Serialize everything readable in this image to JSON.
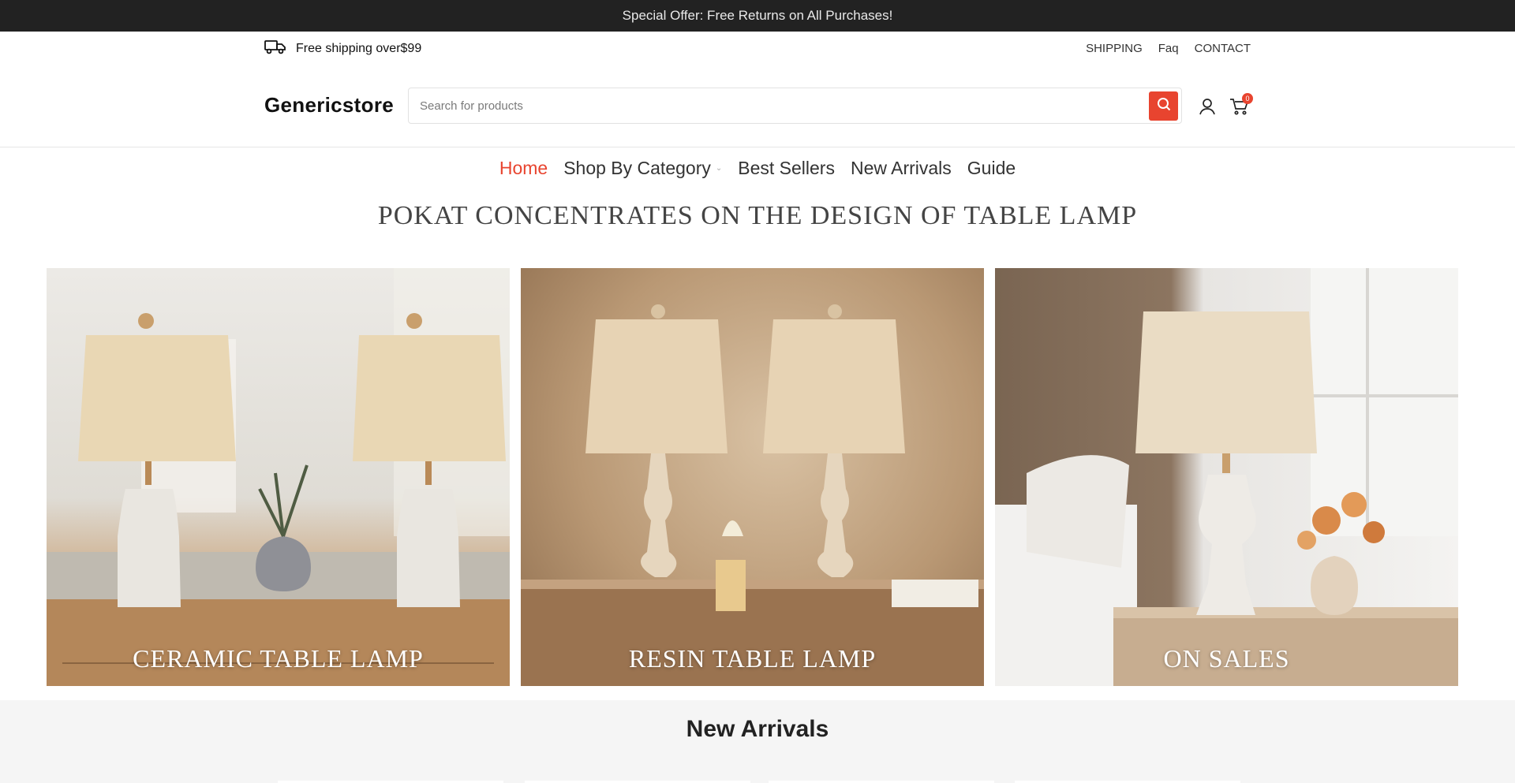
{
  "announcement": "Special Offer: Free Returns on All Purchases!",
  "topbar": {
    "shipping_text": "Free shipping over$99",
    "links": [
      "SHIPPING",
      "Faq",
      "CONTACT"
    ]
  },
  "header": {
    "logo": "Genericstore",
    "search_placeholder": "Search for products",
    "cart_count": "0"
  },
  "nav": {
    "items": [
      "Home",
      "Shop By Category",
      "Best Sellers",
      "New Arrivals",
      "Guide"
    ],
    "active": "Home"
  },
  "headline": "POKAT CONCENTRATES ON THE DESIGN OF TABLE LAMP",
  "tiles": [
    {
      "label": "CERAMIC TABLE LAMP"
    },
    {
      "label": "RESIN TABLE LAMP"
    },
    {
      "label": "ON SALES"
    }
  ],
  "section_title": "New Arrivals",
  "colors": {
    "accent": "#e8442f",
    "announcement_bg": "#222222"
  }
}
